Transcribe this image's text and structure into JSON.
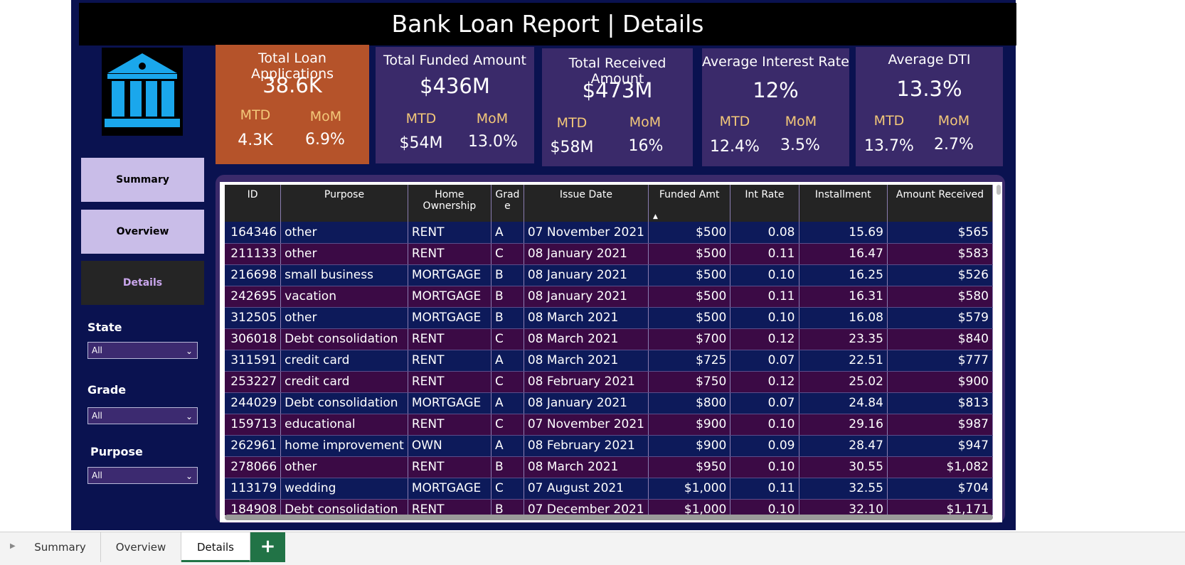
{
  "report": {
    "title": "Bank Loan Report | Details",
    "logo_icon": "bank-building-icon",
    "logo_color": "#1aa7ec"
  },
  "kpis": [
    {
      "title": "Total Loan Applications",
      "value": "38.6K",
      "mtd_label": "MTD",
      "mom_label": "MoM",
      "mtd": "4.3K",
      "mom": "6.9%",
      "bg": "#b5532a"
    },
    {
      "title": "Total Funded Amount",
      "value": "$436M",
      "mtd_label": "MTD",
      "mom_label": "MoM",
      "mtd": "$54M",
      "mom": "13.0%",
      "bg": "#3a2a6a"
    },
    {
      "title": "Total Received Amount",
      "value": "$473M",
      "mtd_label": "MTD",
      "mom_label": "MoM",
      "mtd": "$58M",
      "mom": "16%",
      "bg": "#3a2a6a"
    },
    {
      "title": "Average Interest Rate",
      "value": "12%",
      "mtd_label": "MTD",
      "mom_label": "MoM",
      "mtd": "12.4%",
      "mom": "3.5%",
      "bg": "#3a2a6a"
    },
    {
      "title": "Average DTI",
      "value": "13.3%",
      "mtd_label": "MTD",
      "mom_label": "MoM",
      "mtd": "13.7%",
      "mom": "2.7%",
      "bg": "#3a2a6a"
    }
  ],
  "nav": {
    "summary": "Summary",
    "overview": "Overview",
    "details": "Details"
  },
  "slicers": {
    "state": {
      "label": "State",
      "value": "All"
    },
    "grade": {
      "label": "Grade",
      "value": "All"
    },
    "purpose": {
      "label": "Purpose",
      "value": "All"
    }
  },
  "table": {
    "columns": [
      "ID",
      "Purpose",
      "Home Ownership",
      "Grad e",
      "Issue Date",
      "Funded Amt",
      "Int Rate",
      "Installment",
      "Amount Received"
    ],
    "rows": [
      [
        "164346",
        "other",
        "RENT",
        "A",
        "07 November 2021",
        "$500",
        "0.08",
        "15.69",
        "$565"
      ],
      [
        "211133",
        "other",
        "RENT",
        "C",
        "08 January 2021",
        "$500",
        "0.11",
        "16.47",
        "$583"
      ],
      [
        "216698",
        "small business",
        "MORTGAGE",
        "B",
        "08 January 2021",
        "$500",
        "0.10",
        "16.25",
        "$526"
      ],
      [
        "242695",
        "vacation",
        "MORTGAGE",
        "B",
        "08 January 2021",
        "$500",
        "0.11",
        "16.31",
        "$580"
      ],
      [
        "312505",
        "other",
        "MORTGAGE",
        "B",
        "08 March 2021",
        "$500",
        "0.10",
        "16.08",
        "$579"
      ],
      [
        "306018",
        "Debt consolidation",
        "RENT",
        "C",
        "08 March 2021",
        "$700",
        "0.12",
        "23.35",
        "$840"
      ],
      [
        "311591",
        "credit card",
        "RENT",
        "A",
        "08 March 2021",
        "$725",
        "0.07",
        "22.51",
        "$777"
      ],
      [
        "253227",
        "credit card",
        "RENT",
        "C",
        "08 February 2021",
        "$750",
        "0.12",
        "25.02",
        "$900"
      ],
      [
        "244029",
        "Debt consolidation",
        "MORTGAGE",
        "A",
        "08 January 2021",
        "$800",
        "0.07",
        "24.84",
        "$813"
      ],
      [
        "159713",
        "educational",
        "RENT",
        "C",
        "07 November 2021",
        "$900",
        "0.10",
        "29.16",
        "$987"
      ],
      [
        "262961",
        "home improvement",
        "OWN",
        "A",
        "08 February 2021",
        "$900",
        "0.09",
        "28.47",
        "$947"
      ],
      [
        "278066",
        "other",
        "RENT",
        "B",
        "08 March 2021",
        "$950",
        "0.10",
        "30.55",
        "$1,082"
      ],
      [
        "113179",
        "wedding",
        "MORTGAGE",
        "C",
        "07 August 2021",
        "$1,000",
        "0.11",
        "32.55",
        "$704"
      ],
      [
        "184908",
        "Debt consolidation",
        "RENT",
        "B",
        "07 December 2021",
        "$1,000",
        "0.10",
        "32.10",
        "$1,171"
      ]
    ]
  },
  "sheet_tabs": {
    "summary": "Summary",
    "overview": "Overview",
    "details": "Details",
    "add": "+"
  }
}
